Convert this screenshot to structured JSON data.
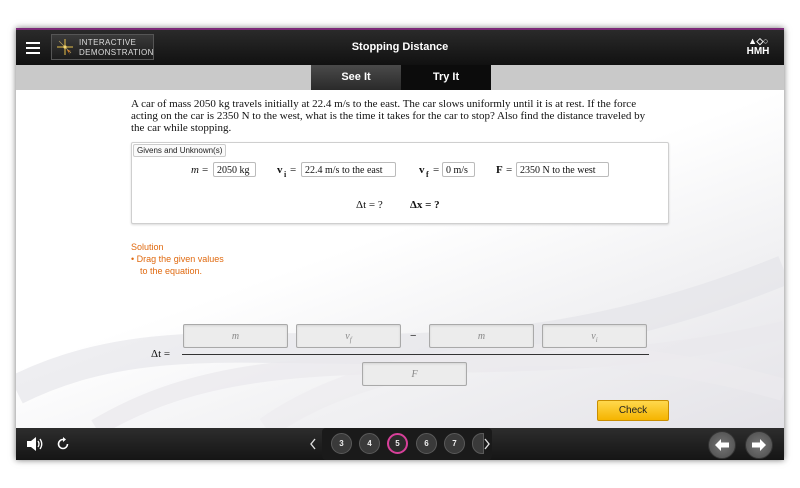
{
  "header": {
    "brand_line1": "INTERACTIVE",
    "brand_line2": "DEMONSTRATION",
    "title": "Stopping Distance",
    "logo_text": "HMH"
  },
  "tabs": [
    {
      "label": "See It"
    },
    {
      "label": "Try It"
    }
  ],
  "problem": {
    "text": "A car of mass 2050 kg travels initially at 22.4 m/s to the east. The car slows uniformly until it is at rest. If the force acting on the car is 2350 N to the west, what is the time it takes for the car to stop? Also find the distance traveled by the car while stopping."
  },
  "givens": {
    "label": "Givens and Unknown(s)",
    "m_var": "m",
    "m_value": "2050 kg",
    "vi_var": "v",
    "vi_sub": "i",
    "vi_value": "22.4 m/s to the east",
    "vf_var": "v",
    "vf_sub": "f",
    "vf_value": "0 m/s",
    "F_var": "F",
    "F_value": "2350 N to the west",
    "unknown_dt": "Δt = ?",
    "unknown_dx": "Δx = ?",
    "equals": "="
  },
  "solution": {
    "title": "Solution",
    "bullet": "•",
    "step_line1": "Drag the given values",
    "step_line2": "to the equation."
  },
  "equation": {
    "lhs": "Δt = ",
    "num_box1": "m",
    "num_box2": "v",
    "num_box2_sub": "f",
    "minus": "−",
    "num_box3": "m",
    "num_box4": "v",
    "num_box4_sub": "i",
    "den_box": "F"
  },
  "check_label": "Check",
  "pager": {
    "pages": [
      "3",
      "4",
      "5",
      "6",
      "7"
    ],
    "current": "5"
  },
  "icons": {
    "menu": "menu-icon",
    "sound": "speaker-icon",
    "reset": "reload-icon",
    "prev": "chevron-left-icon",
    "next": "chevron-right-icon",
    "back": "arrow-left-icon",
    "forward": "arrow-right-icon"
  },
  "colors": {
    "accent": "#e06a10",
    "check_button": "#f5b400",
    "active_page_ring": "#d8409a",
    "header_stripe": "#7c2a78"
  }
}
